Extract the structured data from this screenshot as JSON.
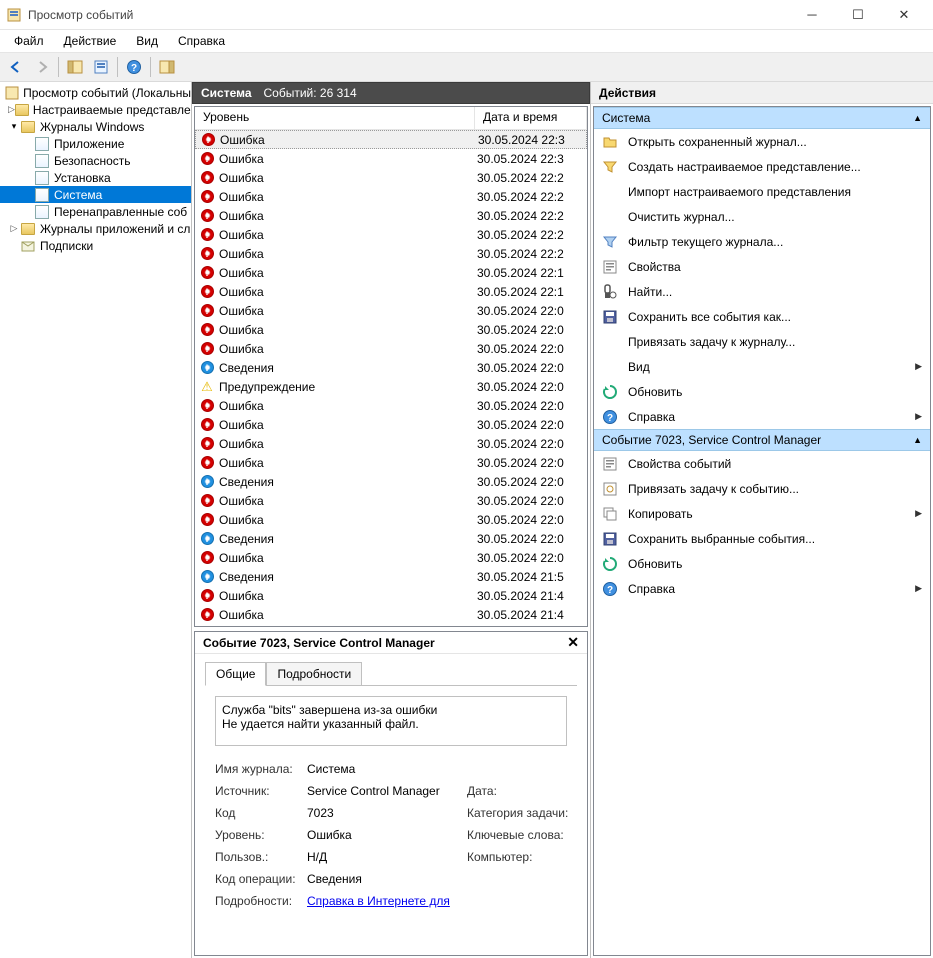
{
  "titlebar": {
    "title": "Просмотр событий"
  },
  "menubar": [
    "Файл",
    "Действие",
    "Вид",
    "Справка"
  ],
  "tree": {
    "root": "Просмотр событий (Локальны",
    "customViews": "Настраиваемые представлен",
    "winLogs": "Журналы Windows",
    "winLogsItems": [
      "Приложение",
      "Безопасность",
      "Установка",
      "Система",
      "Перенаправленные соб"
    ],
    "appLogs": "Журналы приложений и сл",
    "subscriptions": "Подписки"
  },
  "centerHeader": {
    "title": "Система",
    "count": "Событий: 26 314"
  },
  "columns": {
    "level": "Уровень",
    "datetime": "Дата и время"
  },
  "levels": {
    "error": "Ошибка",
    "info": "Сведения",
    "warning": "Предупреждение"
  },
  "events": [
    {
      "lvl": "error",
      "dt": "30.05.2024 22:3",
      "selected": true
    },
    {
      "lvl": "error",
      "dt": "30.05.2024 22:3"
    },
    {
      "lvl": "error",
      "dt": "30.05.2024 22:2"
    },
    {
      "lvl": "error",
      "dt": "30.05.2024 22:2"
    },
    {
      "lvl": "error",
      "dt": "30.05.2024 22:2"
    },
    {
      "lvl": "error",
      "dt": "30.05.2024 22:2"
    },
    {
      "lvl": "error",
      "dt": "30.05.2024 22:2"
    },
    {
      "lvl": "error",
      "dt": "30.05.2024 22:1"
    },
    {
      "lvl": "error",
      "dt": "30.05.2024 22:1"
    },
    {
      "lvl": "error",
      "dt": "30.05.2024 22:0"
    },
    {
      "lvl": "error",
      "dt": "30.05.2024 22:0"
    },
    {
      "lvl": "error",
      "dt": "30.05.2024 22:0"
    },
    {
      "lvl": "info",
      "dt": "30.05.2024 22:0"
    },
    {
      "lvl": "warning",
      "dt": "30.05.2024 22:0"
    },
    {
      "lvl": "error",
      "dt": "30.05.2024 22:0"
    },
    {
      "lvl": "error",
      "dt": "30.05.2024 22:0"
    },
    {
      "lvl": "error",
      "dt": "30.05.2024 22:0"
    },
    {
      "lvl": "error",
      "dt": "30.05.2024 22:0"
    },
    {
      "lvl": "info",
      "dt": "30.05.2024 22:0"
    },
    {
      "lvl": "error",
      "dt": "30.05.2024 22:0"
    },
    {
      "lvl": "error",
      "dt": "30.05.2024 22:0"
    },
    {
      "lvl": "info",
      "dt": "30.05.2024 22:0"
    },
    {
      "lvl": "error",
      "dt": "30.05.2024 22:0"
    },
    {
      "lvl": "info",
      "dt": "30.05.2024 21:5"
    },
    {
      "lvl": "error",
      "dt": "30.05.2024 21:4"
    },
    {
      "lvl": "error",
      "dt": "30.05.2024 21:4"
    }
  ],
  "details": {
    "header": "Событие 7023, Service Control Manager",
    "tabs": {
      "general": "Общие",
      "details": "Подробности"
    },
    "text1": "Служба \"bits\" завершена из-за ошибки",
    "text2": "Не удается найти указанный файл.",
    "labels": {
      "logName": "Имя журнала:",
      "source": "Источник:",
      "code": "Код",
      "level": "Уровень:",
      "user": "Пользов.:",
      "opcode": "Код операции:",
      "details": "Подробности:",
      "date": "Дата:",
      "category": "Категория задачи:",
      "keywords": "Ключевые слова:",
      "computer": "Компьютер:"
    },
    "values": {
      "logName": "Система",
      "source": "Service Control Manager",
      "code": "7023",
      "level": "Ошибка",
      "user": "Н/Д",
      "opcode": "Сведения"
    },
    "link": "Справка в Интернете для "
  },
  "actions": {
    "header": "Действия",
    "section1": "Система",
    "section2": "Событие 7023, Service Control Manager",
    "items1": [
      {
        "icon": "open",
        "label": "Открыть сохраненный журнал..."
      },
      {
        "icon": "filter",
        "label": "Создать настраиваемое представление..."
      },
      {
        "icon": "none",
        "label": "Импорт настраиваемого представления"
      },
      {
        "icon": "none",
        "label": "Очистить журнал..."
      },
      {
        "icon": "filter2",
        "label": "Фильтр текущего журнала..."
      },
      {
        "icon": "props",
        "label": "Свойства"
      },
      {
        "icon": "find",
        "label": "Найти..."
      },
      {
        "icon": "save",
        "label": "Сохранить все события как..."
      },
      {
        "icon": "none",
        "label": "Привязать задачу к журналу..."
      },
      {
        "icon": "none",
        "label": "Вид",
        "hasArrow": true
      },
      {
        "icon": "refresh",
        "label": "Обновить"
      },
      {
        "icon": "help",
        "label": "Справка",
        "hasArrow": true
      }
    ],
    "items2": [
      {
        "icon": "props",
        "label": "Свойства событий"
      },
      {
        "icon": "attach",
        "label": "Привязать задачу к событию..."
      },
      {
        "icon": "copy",
        "label": "Копировать",
        "hasArrow": true
      },
      {
        "icon": "save",
        "label": "Сохранить выбранные события..."
      },
      {
        "icon": "refresh",
        "label": "Обновить"
      },
      {
        "icon": "help",
        "label": "Справка",
        "hasArrow": true
      }
    ]
  }
}
